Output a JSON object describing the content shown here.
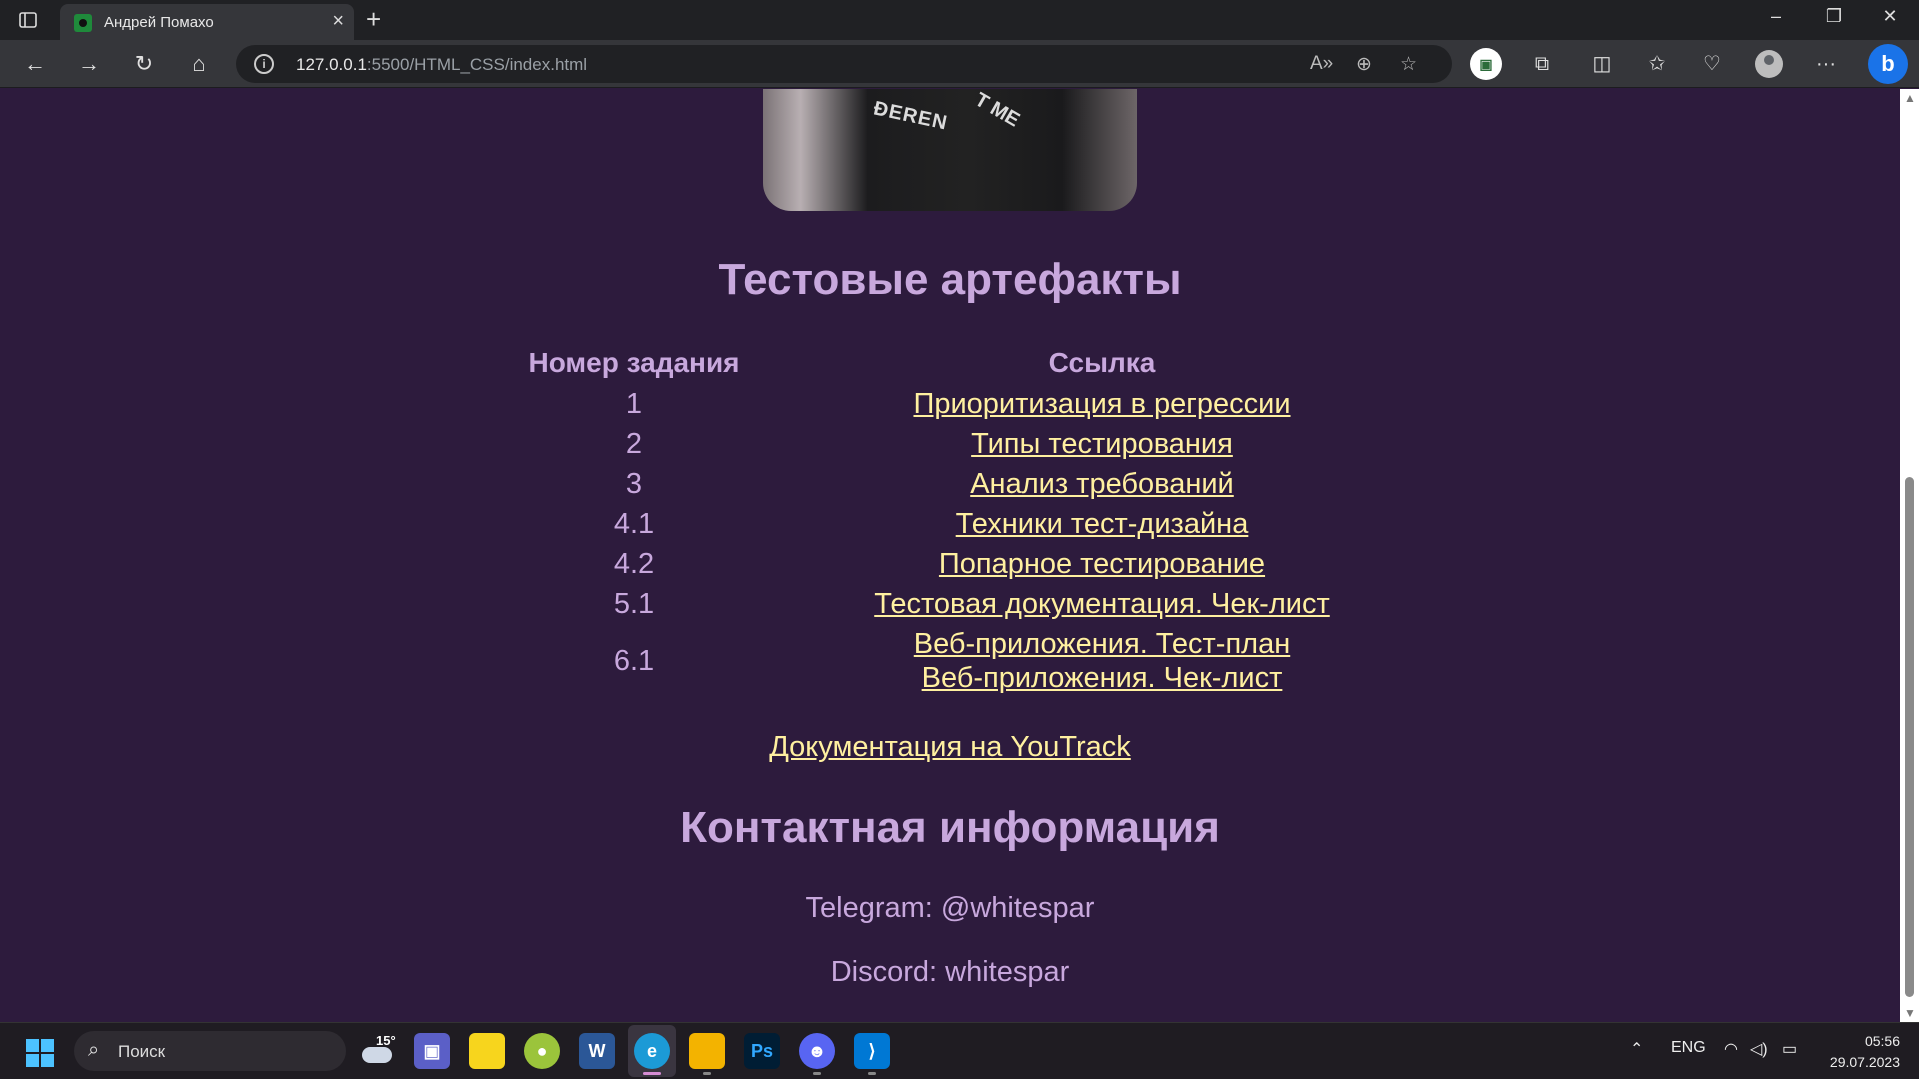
{
  "browser": {
    "tab_title": "Андрей Помахо",
    "url_host": "127.0.0.1",
    "url_path": ":5500/HTML_CSS/index.html",
    "icons": {
      "back": "back-arrow-icon",
      "forward": "forward-arrow-icon",
      "refresh": "refresh-icon",
      "home": "home-icon",
      "read_aloud": "read-aloud-icon",
      "zoom": "zoom-icon",
      "favorite": "star-icon",
      "extensions": "puzzle-icon",
      "split": "split-screen-icon",
      "favorites": "favorites-icon",
      "health": "browser-essentials-icon",
      "menu": "more-icon",
      "copilot": "bing-icon"
    },
    "copilot_label": "b"
  },
  "page": {
    "artifacts_title": "Тестовые артефакты",
    "table": {
      "headers": [
        "Номер задания",
        "Ссылка"
      ],
      "rows": [
        {
          "num": "1",
          "links": [
            "Приоритизация в регрессии"
          ]
        },
        {
          "num": "2",
          "links": [
            "Типы тестирования"
          ]
        },
        {
          "num": "3",
          "links": [
            "Анализ требований"
          ]
        },
        {
          "num": "4.1",
          "links": [
            "Техники тест-дизайна"
          ]
        },
        {
          "num": "4.2",
          "links": [
            "Попарное тестирование"
          ]
        },
        {
          "num": "5.1",
          "links": [
            "Тестовая документация. Чек-лист"
          ]
        },
        {
          "num": "6.1",
          "links": [
            "Веб-приложения. Тест-план",
            "Веб-приложения. Чек-лист"
          ]
        }
      ]
    },
    "youtrack_link": "Документация на YouTrack",
    "contact_title": "Контактная информация",
    "telegram": "Telegram: @whitespar",
    "discord": "Discord: whitespar",
    "colors": {
      "background": "#2d1b3d",
      "heading": "#c8a8dd",
      "link": "#fff0a0"
    }
  },
  "taskbar": {
    "search_placeholder": "Поиск",
    "weather_temp": "15°",
    "language": "ENG",
    "time": "05:56",
    "date": "29.07.2023",
    "apps": [
      {
        "name": "teams",
        "label": "▣",
        "color": "#5b5fc7"
      },
      {
        "name": "sticky-notes",
        "label": "",
        "color": "#f7d51d"
      },
      {
        "name": "tennis",
        "label": "●",
        "color": "#9bc43b"
      },
      {
        "name": "word",
        "label": "W",
        "color": "#2b5797"
      },
      {
        "name": "edge",
        "label": "e",
        "color": "#1c9ad6"
      },
      {
        "name": "explorer",
        "label": "",
        "color": "#f3b300"
      },
      {
        "name": "photoshop",
        "label": "Ps",
        "color": "#001d34"
      },
      {
        "name": "discord",
        "label": "☻",
        "color": "#5865f2"
      },
      {
        "name": "vscode",
        "label": "⟩",
        "color": "#0078d4"
      }
    ]
  }
}
